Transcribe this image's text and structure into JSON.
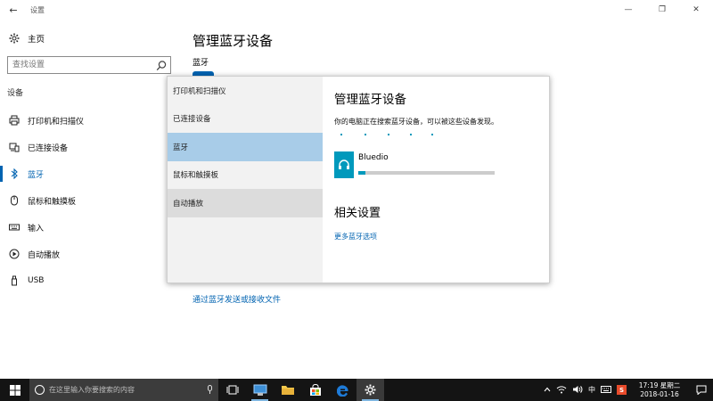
{
  "window": {
    "title": "设置",
    "back_glyph": "←",
    "controls": {
      "minimize": "—",
      "maximize": "❐",
      "close": "✕"
    }
  },
  "nav": {
    "home_label": "主页",
    "search_placeholder": "查找设置",
    "section_label": "设备",
    "items": [
      {
        "label": "打印机和扫描仪",
        "icon": "printer-icon"
      },
      {
        "label": "已连接设备",
        "icon": "devices-icon"
      },
      {
        "label": "蓝牙",
        "icon": "bluetooth-icon",
        "active": true
      },
      {
        "label": "鼠标和触摸板",
        "icon": "mouse-icon"
      },
      {
        "label": "输入",
        "icon": "keyboard-icon"
      },
      {
        "label": "自动播放",
        "icon": "autoplay-icon"
      },
      {
        "label": "USB",
        "icon": "usb-icon"
      }
    ]
  },
  "main": {
    "title": "管理蓝牙设备",
    "bluetooth_label": "蓝牙",
    "send_receive_link": "通过蓝牙发送或接收文件"
  },
  "popup": {
    "items": [
      {
        "label": "打印机和扫描仪"
      },
      {
        "label": "已连接设备"
      },
      {
        "label": "蓝牙",
        "state": "selected"
      },
      {
        "label": "鼠标和触摸板"
      },
      {
        "label": "自动播放",
        "state": "hover"
      }
    ],
    "title": "管理蓝牙设备",
    "description": "你的电脑正在搜索蓝牙设备，可以被这些设备发现。",
    "device": {
      "name": "Bluedio",
      "icon": "headset-icon",
      "progress_fraction": 0.05
    },
    "related_title": "相关设置",
    "more_bluetooth_link": "更多蓝牙选项"
  },
  "taskbar": {
    "search_placeholder": "在这里输入你要搜索的内容",
    "apps": [
      "task-view-icon",
      "control-panel-icon",
      "file-explorer-icon",
      "store-icon",
      "edge-icon",
      "settings-icon"
    ],
    "tray": {
      "ime": "中",
      "antivirus_badge": "S"
    },
    "clock": {
      "time": "17:19 星期二",
      "date": "2018-01-16"
    }
  },
  "colors": {
    "accent": "#0063b1",
    "selected_bg": "#a8cce8",
    "taskbar_bg": "#141414",
    "device_accent": "#0099bc"
  }
}
